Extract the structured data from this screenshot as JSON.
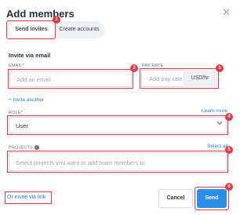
{
  "modal": {
    "title": "Add members",
    "close_symbol": "✕"
  },
  "tabs": [
    {
      "label": "Send invites",
      "active": true
    },
    {
      "label": "Create accounts",
      "active": false
    }
  ],
  "section": {
    "title": "Invite via email"
  },
  "email": {
    "label": "EMAIL",
    "required_mark": "*",
    "placeholder": "Add an email"
  },
  "pay_rate": {
    "label": "PAY RATE",
    "placeholder": "Add pay rate",
    "unit": "USD/hr"
  },
  "invite_another": "+ Invite another",
  "role": {
    "label": "ROLE",
    "required_mark": "*",
    "learn_more": "Learn more",
    "value": "User",
    "chevron_icon": "chevron-down-icon"
  },
  "projects": {
    "label": "PROJECTS",
    "info_icon": "info-icon",
    "select_all": "Select all",
    "placeholder": "Select projects you want to add team members to"
  },
  "footer": {
    "invite_link": "Or invite via link",
    "cancel": "Cancel",
    "send": "Send"
  },
  "annotations": {
    "badges": [
      "1",
      "2",
      "3",
      "4",
      "5",
      "6"
    ],
    "highlight_color": "#e53946"
  },
  "colors": {
    "primary": "#2a8de9",
    "link": "#2a7de1",
    "highlight": "#e53946"
  }
}
